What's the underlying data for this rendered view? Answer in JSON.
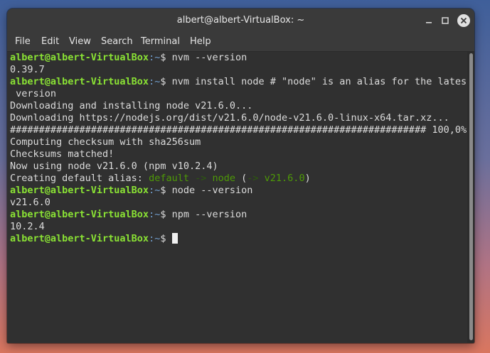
{
  "window": {
    "title": "albert@albert-VirtualBox: ~"
  },
  "menu": [
    "File",
    "Edit",
    "View",
    "Search",
    "Terminal",
    "Help"
  ],
  "prompt": {
    "user": "albert@albert-VirtualBox",
    "path": ":~",
    "symbol": "$ "
  },
  "lines": {
    "l1_cmd": "nvm --version",
    "l2": "0.39.7",
    "l3_cmd": "nvm install node # \"node\" is an alias for the latest",
    "l4": " version",
    "l5": "Downloading and installing node v21.6.0...",
    "l6": "Downloading https://nodejs.org/dist/v21.6.0/node-v21.6.0-linux-x64.tar.xz...",
    "l7": "######################################################################## 100,0%",
    "l8": "Computing checksum with sha256sum",
    "l9": "Checksums matched!",
    "l10": "Now using node v21.6.0 (npm v10.2.4)",
    "l11_pre": "Creating default alias: ",
    "l11_a": "default",
    "l11_b": " -> ",
    "l11_c": "node",
    "l11_d": " (",
    "l11_e": "-> ",
    "l11_f": "v21.6.0",
    "l11_g": ")",
    "l12_cmd": "node --version",
    "l13": "v21.6.0",
    "l14_cmd": "npm --version",
    "l15": "10.2.4"
  },
  "icons": {
    "minimize": "minimize-icon",
    "maximize": "maximize-icon",
    "close": "close-icon"
  }
}
